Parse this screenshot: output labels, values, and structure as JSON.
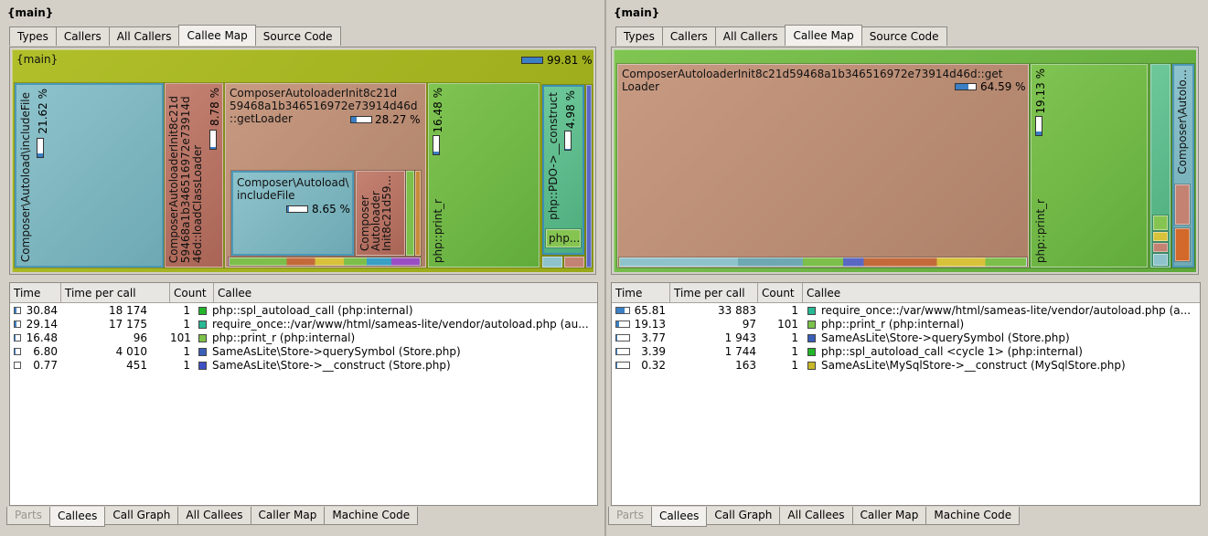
{
  "left": {
    "title": "{main}",
    "tabs": [
      "Types",
      "Callers",
      "All Callers",
      "Callee Map",
      "Source Code"
    ],
    "active_tab": "Callee Map",
    "map": {
      "root_label": "{main}",
      "root_pct": "99.81 %",
      "root_fraction": 0.998,
      "cells": {
        "includeFile_a": {
          "label": "Composer\\Autoload\\includeFile",
          "pct": "21.62 %",
          "fraction": 0.22
        },
        "loadClassLoader": {
          "label": "ComposerAutoloaderInit8c21d\n59468a1b346516972e73914d\n46d::loadClassLoader",
          "pct": "8.78 %",
          "fraction": 0.09
        },
        "getLoader": {
          "label": "ComposerAutoloaderInit8c21d\n59468a1b346516972e73914d46d\n::getLoader",
          "pct": "28.27 %",
          "fraction": 0.28
        },
        "includeFile_b": {
          "label": "Composer\\Autoload\\\nincludeFile",
          "pct": "8.65 %",
          "fraction": 0.09
        },
        "autoloader_small": {
          "label": "Composer\nAutoloader\nInit8c21d59..."
        },
        "print_r": {
          "label": "php::print_r",
          "pct": "16.48 %",
          "fraction": 0.16
        },
        "pdo_construct": {
          "label": "php::PDO->__construct",
          "pct": "4.98 %",
          "fraction": 0.05
        },
        "php_small": {
          "label": "php..."
        }
      }
    },
    "list": {
      "columns": [
        "Time",
        "Time per call",
        "Count",
        "Callee"
      ],
      "rows": [
        {
          "time": "30.84",
          "tpc": "18 174",
          "count": "1",
          "callee": "php::spl_autoload_call (php:internal)",
          "color": "#22b52a",
          "fraction": 0.31
        },
        {
          "time": "29.14",
          "tpc": "17 175",
          "count": "1",
          "callee": "require_once::/var/www/html/sameas-lite/vendor/autoload.php (au...",
          "color": "#27b894",
          "fraction": 0.29
        },
        {
          "time": "16.48",
          "tpc": "96",
          "count": "101",
          "callee": "php::print_r (php:internal)",
          "color": "#7cc24a",
          "fraction": 0.16
        },
        {
          "time": "6.80",
          "tpc": "4 010",
          "count": "1",
          "callee": "SameAsLite\\Store->querySymbol (Store.php)",
          "color": "#3a5fb8",
          "fraction": 0.07
        },
        {
          "time": "0.77",
          "tpc": "451",
          "count": "1",
          "callee": "SameAsLite\\Store->__construct (Store.php)",
          "color": "#3d4fc4",
          "fraction": 0.01
        }
      ]
    },
    "bottom_tabs": [
      "Parts",
      "Callees",
      "Call Graph",
      "All Callees",
      "Caller Map",
      "Machine Code"
    ],
    "bottom_active": "Callees",
    "bottom_disabled": "Parts"
  },
  "right": {
    "title": "{main}",
    "tabs": [
      "Types",
      "Callers",
      "All Callers",
      "Callee Map",
      "Source Code"
    ],
    "active_tab": "Callee Map",
    "map": {
      "cells": {
        "getLoader": {
          "label": "ComposerAutoloaderInit8c21d59468a1b346516972e73914d46d::get\nLoader",
          "pct": "64.59 %",
          "fraction": 0.65
        },
        "print_r": {
          "label": "php::print_r",
          "pct": "19.13 %",
          "fraction": 0.19
        },
        "composer_auto": {
          "label": "Composer\\Autolo..."
        }
      }
    },
    "list": {
      "columns": [
        "Time",
        "Time per call",
        "Count",
        "Callee"
      ],
      "rows": [
        {
          "time": "65.81",
          "tpc": "33 883",
          "count": "1",
          "callee": "require_once::/var/www/html/sameas-lite/vendor/autoload.php (a...",
          "color": "#27b894",
          "fraction": 0.66
        },
        {
          "time": "19.13",
          "tpc": "97",
          "count": "101",
          "callee": "php::print_r (php:internal)",
          "color": "#7cc24a",
          "fraction": 0.19
        },
        {
          "time": "3.77",
          "tpc": "1 943",
          "count": "1",
          "callee": "SameAsLite\\Store->querySymbol (Store.php)",
          "color": "#3a5fb8",
          "fraction": 0.04
        },
        {
          "time": "3.39",
          "tpc": "1 744",
          "count": "1",
          "callee": "php::spl_autoload_call <cycle 1> (php:internal)",
          "color": "#22b52a",
          "fraction": 0.03
        },
        {
          "time": "0.32",
          "tpc": "163",
          "count": "1",
          "callee": "SameAsLite\\MySqlStore->__construct (MySqlStore.php)",
          "color": "#c8b82a",
          "fraction": 0.01
        }
      ]
    },
    "bottom_tabs": [
      "Parts",
      "Callees",
      "Call Graph",
      "All Callees",
      "Caller Map",
      "Machine Code"
    ],
    "bottom_active": "Callees",
    "bottom_disabled": "Parts"
  }
}
